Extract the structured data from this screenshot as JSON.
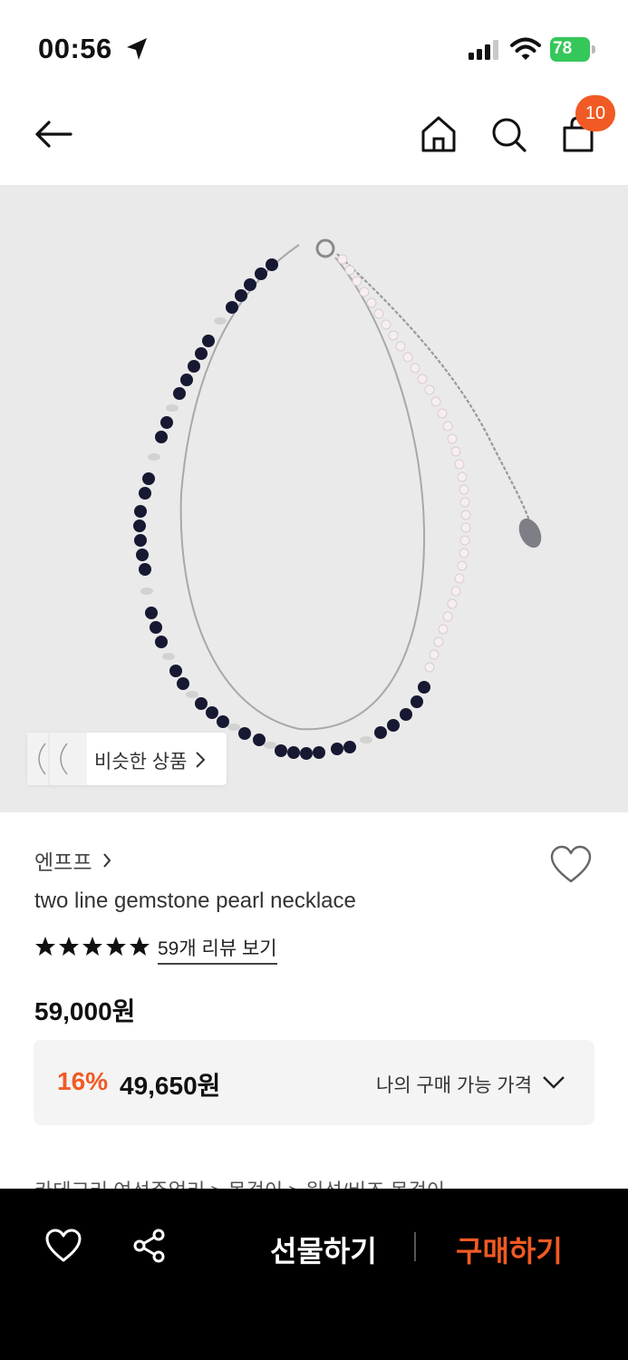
{
  "status_bar": {
    "time": "00:56",
    "battery": "78"
  },
  "header": {
    "cart_count": "10"
  },
  "similar_products": {
    "label": "비슷한 상품"
  },
  "product": {
    "brand": "엔프프",
    "name": "two line gemstone pearl necklace",
    "rating_stars": 5,
    "review_link": "59개 리뷰 보기",
    "price": "59,000원",
    "discount_rate": "16%",
    "discount_price": "49,650원",
    "my_price_label": "나의 구매 가능 가격",
    "category_peek": "카테고리        여성주얼리  >  목걸이  >  원석/비즈 목걸이"
  },
  "bottom_bar": {
    "gift_label": "선물하기",
    "buy_label": "구매하기"
  },
  "colors": {
    "accent": "#f15a24",
    "battery_green": "#35c759",
    "image_bg": "#eaeaea"
  },
  "icons": [
    "location-arrow-icon",
    "signal-icon",
    "wifi-icon",
    "back-arrow-icon",
    "home-icon",
    "search-icon",
    "shopping-bag-icon",
    "heart-icon",
    "star-icon",
    "chevron-right-icon",
    "chevron-down-icon",
    "share-icon"
  ]
}
